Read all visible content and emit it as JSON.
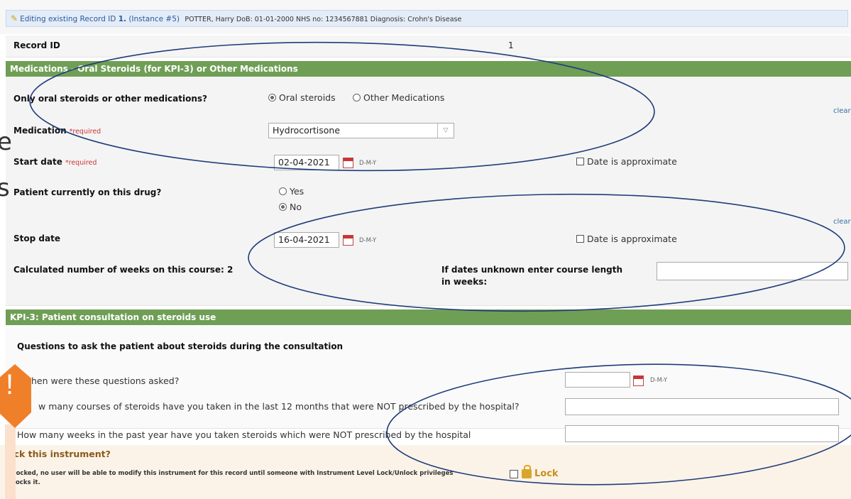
{
  "edit_bar": {
    "text_prefix": "Editing existing Record ID ",
    "record_id": "1.",
    "instance": "(Instance #5)",
    "patient_meta": "POTTER, Harry DoB: 01-01-2000 NHS no: 1234567881 Diagnosis: Crohn's Disease"
  },
  "record": {
    "label": "Record ID",
    "value": "1"
  },
  "section_meds": {
    "title": "Medications - Oral Steroids (for KPI-3) or Other Medications"
  },
  "oral_or_other": {
    "label": "Only oral steroids or other medications?",
    "options": [
      "Oral steroids",
      "Other Medications"
    ],
    "selected": "Oral steroids"
  },
  "medication": {
    "label": "Medication",
    "required": "*required",
    "value": "Hydrocortisone"
  },
  "start_date": {
    "label": "Start date",
    "required": "*required",
    "value": "02-04-2021",
    "format": "D-M-Y",
    "approx_label": "Date is approximate"
  },
  "currently_on": {
    "label": "Patient currently on this drug?",
    "options": [
      "Yes",
      "No"
    ],
    "selected": "No"
  },
  "stop_date": {
    "label": "Stop date",
    "value": "16-04-2021",
    "format": "D-M-Y",
    "approx_label": "Date is approximate"
  },
  "weeks": {
    "label": "Calculated number of weeks on this course: 2",
    "unknown_label_1": "If dates unknown enter course length",
    "unknown_label_2": "in weeks:",
    "unknown_value": ""
  },
  "clear_label": "clear",
  "section_kpi": {
    "title": "KPI-3: Patient consultation on steroids use"
  },
  "questions_heading": "Questions to ask the patient about steroids during the consultation",
  "q_when": {
    "label": "hen were these questions asked?",
    "value": "",
    "format": "D-M-Y"
  },
  "q_courses": {
    "label": "w many courses of steroids have you taken in the last 12 months that were NOT prescribed by the hospital?",
    "value": ""
  },
  "q_weeks": {
    "label": "How many weeks in the past year have you taken steroids which were NOT prescribed  by the hospital",
    "value": ""
  },
  "lock": {
    "title": "ock this instrument?",
    "note_1": "f locked, no user will be able to modify this instrument for this record until someone with Instrument Level Lock/Unlock privileges",
    "note_2": "nlocks it.",
    "checkbox_label": "Lock"
  },
  "overlay_left_chars": [
    "e",
    "s"
  ],
  "warning_symbol": "!",
  "colors": {
    "section_header": "#6f9e55",
    "edit_bar": "#e4ecf8",
    "annotation": "#1f3d7a",
    "warning": "#f07f2a"
  }
}
